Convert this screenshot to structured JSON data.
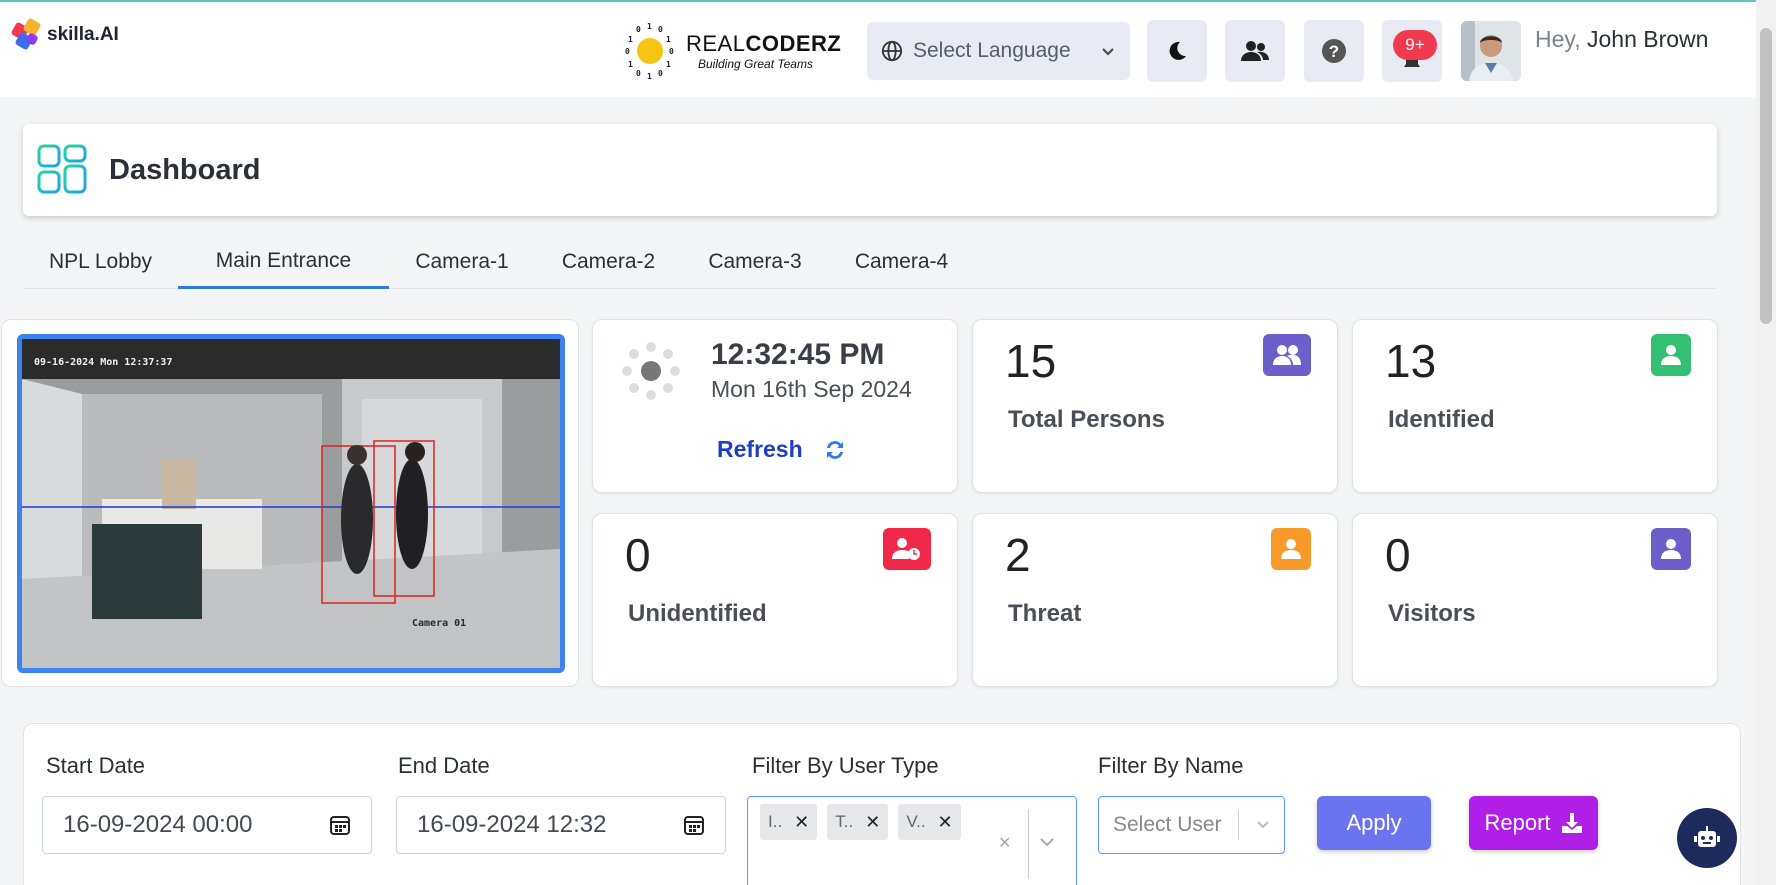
{
  "brand": {
    "name": "skilla.AI"
  },
  "partner": {
    "title_light": "REAL",
    "title_bold": "CODERZ",
    "tagline": "Building Great Teams",
    "bits": [
      "1",
      "0",
      "1",
      "0",
      "1",
      "0",
      "1",
      "0",
      "1",
      "0",
      "1",
      "0"
    ]
  },
  "header": {
    "language_placeholder": "Select Language",
    "notification_count": "9+",
    "greeting_prefix": "Hey,",
    "user_name": "John Brown"
  },
  "page": {
    "title": "Dashboard"
  },
  "tabs": [
    {
      "label": "NPL Lobby",
      "active": false
    },
    {
      "label": "Main Entrance",
      "active": true
    },
    {
      "label": "Camera-1",
      "active": false
    },
    {
      "label": "Camera-2",
      "active": false
    },
    {
      "label": "Camera-3",
      "active": false
    },
    {
      "label": "Camera-4",
      "active": false
    }
  ],
  "camera": {
    "timestamp": "09-16-2024 Mon 12:37:37",
    "label": "Camera 01"
  },
  "clock": {
    "time": "12:32:45 PM",
    "date": "Mon 16th Sep 2024",
    "refresh_label": "Refresh"
  },
  "stats": [
    {
      "value": "15",
      "label": "Total Persons",
      "color": "#6c5fc9"
    },
    {
      "value": "13",
      "label": "Identified",
      "color": "#34c072"
    },
    {
      "value": "0",
      "label": "Unidentified",
      "color": "#f0284a"
    },
    {
      "value": "2",
      "label": "Threat",
      "color": "#f79a2a"
    },
    {
      "value": "0",
      "label": "Visitors",
      "color": "#6c5fc9"
    }
  ],
  "filters": {
    "start_date_label": "Start Date",
    "start_date_value": "16-09-2024 00:00",
    "end_date_label": "End Date",
    "end_date_value": "16-09-2024 12:32",
    "user_type_label": "Filter By User Type",
    "user_type_chips": [
      "I..",
      "T..",
      "V.."
    ],
    "name_label": "Filter By Name",
    "name_placeholder": "Select User",
    "apply_label": "Apply",
    "report_label": "Report"
  },
  "colors": {
    "accent": "#2d7be5",
    "apply": "#6b74f0",
    "report": "#b01ee8"
  }
}
